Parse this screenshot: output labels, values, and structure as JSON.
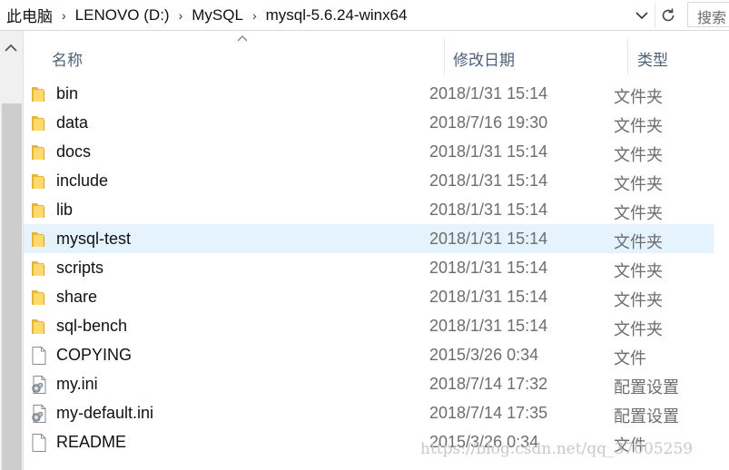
{
  "address_bar": {
    "breadcrumbs": [
      "此电脑",
      "LENOVO (D:)",
      "MySQL",
      "mysql-5.6.24-winx64"
    ],
    "search_placeholder": "搜索"
  },
  "columns": {
    "name": "名称",
    "date_modified": "修改日期",
    "type": "类型"
  },
  "files": [
    {
      "name": "bin",
      "date": "2018/1/31 15:14",
      "type": "文件夹",
      "icon": "folder-icon"
    },
    {
      "name": "data",
      "date": "2018/7/16 19:30",
      "type": "文件夹",
      "icon": "folder-icon"
    },
    {
      "name": "docs",
      "date": "2018/1/31 15:14",
      "type": "文件夹",
      "icon": "folder-icon"
    },
    {
      "name": "include",
      "date": "2018/1/31 15:14",
      "type": "文件夹",
      "icon": "folder-icon"
    },
    {
      "name": "lib",
      "date": "2018/1/31 15:14",
      "type": "文件夹",
      "icon": "folder-icon"
    },
    {
      "name": "mysql-test",
      "date": "2018/1/31 15:14",
      "type": "文件夹",
      "icon": "folder-icon",
      "hovered": true
    },
    {
      "name": "scripts",
      "date": "2018/1/31 15:14",
      "type": "文件夹",
      "icon": "folder-icon"
    },
    {
      "name": "share",
      "date": "2018/1/31 15:14",
      "type": "文件夹",
      "icon": "folder-icon"
    },
    {
      "name": "sql-bench",
      "date": "2018/1/31 15:14",
      "type": "文件夹",
      "icon": "folder-icon"
    },
    {
      "name": "COPYING",
      "date": "2015/3/26 0:34",
      "type": "文件",
      "icon": "file-icon"
    },
    {
      "name": "my.ini",
      "date": "2018/7/14 17:32",
      "type": "配置设置",
      "icon": "settings-file-icon"
    },
    {
      "name": "my-default.ini",
      "date": "2018/7/14 17:35",
      "type": "配置设置",
      "icon": "settings-file-icon"
    },
    {
      "name": "README",
      "date": "2015/3/26 0:34",
      "type": "文件",
      "icon": "file-icon"
    }
  ],
  "watermark": "https://blog.csdn.net/qq_37005259",
  "colors": {
    "hover_row": "#e5f3ff",
    "header_text": "#4c607a",
    "folder_yellow": "#f8d775"
  }
}
